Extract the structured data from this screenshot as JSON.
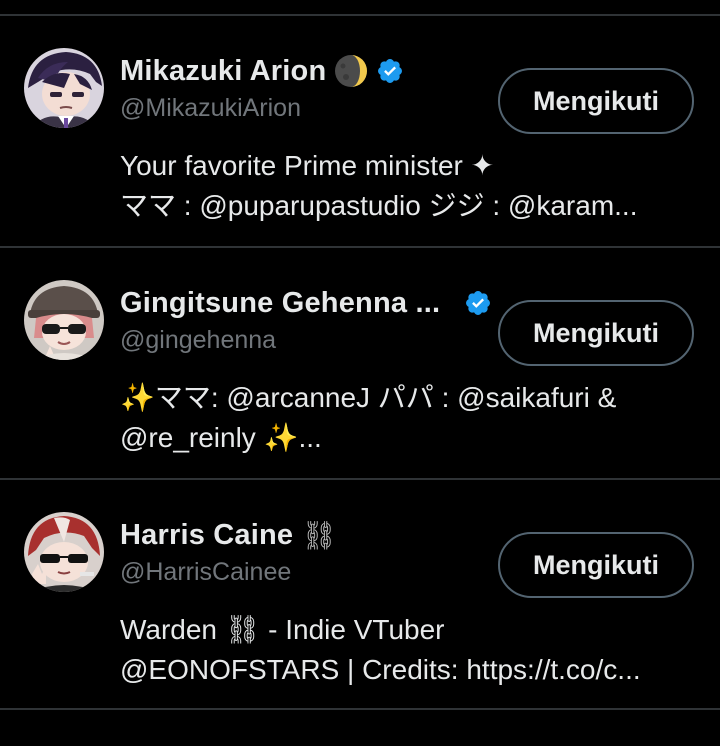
{
  "users": [
    {
      "name": "Mikazuki Arion",
      "handle": "@MikazukiArion",
      "emoji": "moon-icon",
      "verified": true,
      "button_label": "Mengikuti",
      "bio_lines": [
        "Your favorite Prime minister ✦",
        " ママ : @puparupastudio ジジ : @karam..."
      ]
    },
    {
      "name": "Gingitsune Gehenna ...",
      "handle": "@gingehenna",
      "verified": true,
      "button_label": "Mengikuti",
      "bio_lines": [
        "✨ママ: @arcanneJ パパ : @saikafuri &",
        "@re_reinly ✨..."
      ]
    },
    {
      "name": "Harris Caine",
      "handle": "@HarrisCainee",
      "emoji": "⛓",
      "verified": false,
      "button_label": "Mengikuti",
      "bio_lines": [
        "Warden ⛓ - Indie VTuber",
        "@EONOFSTARS | Credits: https://t.co/c..."
      ]
    }
  ],
  "colors": {
    "background": "#000000",
    "primary_text": "#e7e9ea",
    "secondary_text": "#71767b",
    "divider": "#2f3336",
    "button_border": "#536471",
    "verified_badge": "#1d9bf0"
  }
}
